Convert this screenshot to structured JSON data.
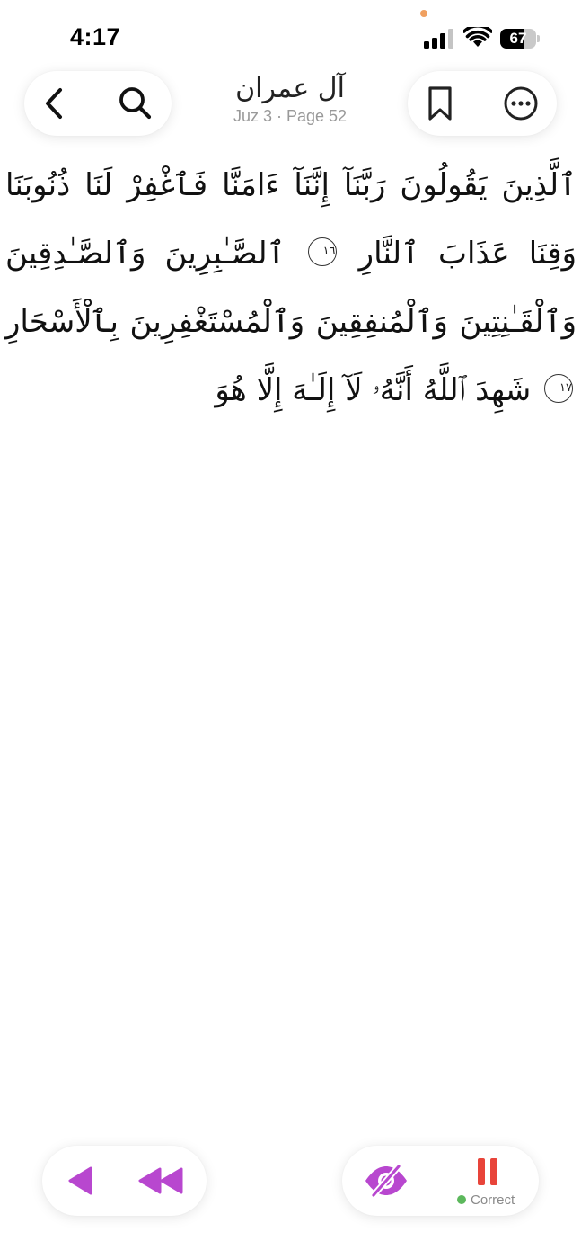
{
  "status_bar": {
    "time": "4:17",
    "battery_percent": "67",
    "battery_level": 0.67,
    "mic_dot_color": "#F0A060"
  },
  "header": {
    "surah_title": "آل عمران",
    "subtitle": "Juz 3 · Page 52",
    "back_icon": "chevron-left-icon",
    "search_icon": "search-icon",
    "bookmark_icon": "bookmark-icon",
    "more_icon": "ellipsis-circle-icon"
  },
  "quran": {
    "segment_1": "ٱلَّذِينَ يَقُولُونَ رَبَّنَآ إِنَّنَآ ءَامَنَّا فَٱغْفِرْ لَنَا ذُنُوبَنَا وَقِنَا عَذَابَ ٱلنَّارِ",
    "ayah_16": "١٦",
    "segment_2": "ٱلصَّـٰبِرِينَ وَٱلصَّـٰدِقِينَ وَٱلْقَـٰنِتِينَ وَٱلْمُنفِقِينَ وَٱلْمُسْتَغْفِرِينَ بِٱلْأَسْحَارِ",
    "ayah_17": "١٧",
    "segment_3": "شَهِدَ ٱللَّهُ أَنَّهُۥ لَآ إِلَـٰهَ إِلَّا هُوَ"
  },
  "controls": {
    "accent_color": "#B847CF",
    "pause_color": "#E8443A",
    "status_label": "Correct",
    "status_color": "#5CB85C",
    "prev_icon": "play-reverse-icon",
    "rewind_icon": "rewind-icon",
    "hide_icon": "eye-slash-icon",
    "pause_icon": "pause-icon"
  }
}
